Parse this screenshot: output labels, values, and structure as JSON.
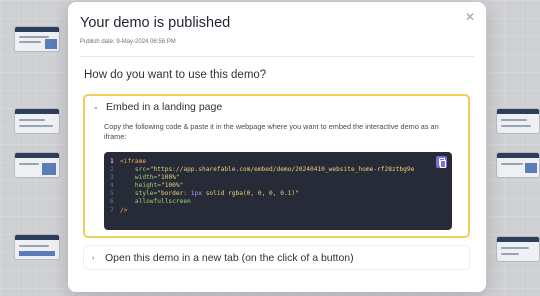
{
  "modal": {
    "title": "Your demo is published",
    "publish_date": "Publish date: 9-May-2024 06:56 PM",
    "close_icon": "close-icon",
    "question": "How do you want to use this demo?"
  },
  "embed_section": {
    "title": "Embed in a landing page",
    "expanded": true,
    "description": "Copy the following code & paste it in the webpage where you want to embed the interactive demo as an iframe:",
    "copy_icon": "copy-icon",
    "code": {
      "line_numbers": [
        "1",
        "2",
        "3",
        "4",
        "5",
        "6",
        "7"
      ],
      "l1_tag": "<iframe",
      "l2_attr": "src=",
      "l2_val": "\"https://app.sharefable.com/embed/demo/20240410_website_home-rf28ztbg9e",
      "l3_attr": "width=",
      "l3_val": "\"100%\"",
      "l4_attr": "height=",
      "l4_val": "\"100%\"",
      "l5_attr": "style=",
      "l5_a": "\"border: ",
      "l5_num": "1px",
      "l5_b": " solid rgba(0, 0, 0, 0.1)\"",
      "l6_attr": "allowfullscreen",
      "l7_tag": "/>"
    }
  },
  "newtab_section": {
    "title": "Open this demo in a new tab (on the click of a button)",
    "expanded": false
  },
  "colors": {
    "accent_border": "#f1cd5a",
    "code_bg": "#272b38",
    "copy_button": "#7b6fe0"
  }
}
